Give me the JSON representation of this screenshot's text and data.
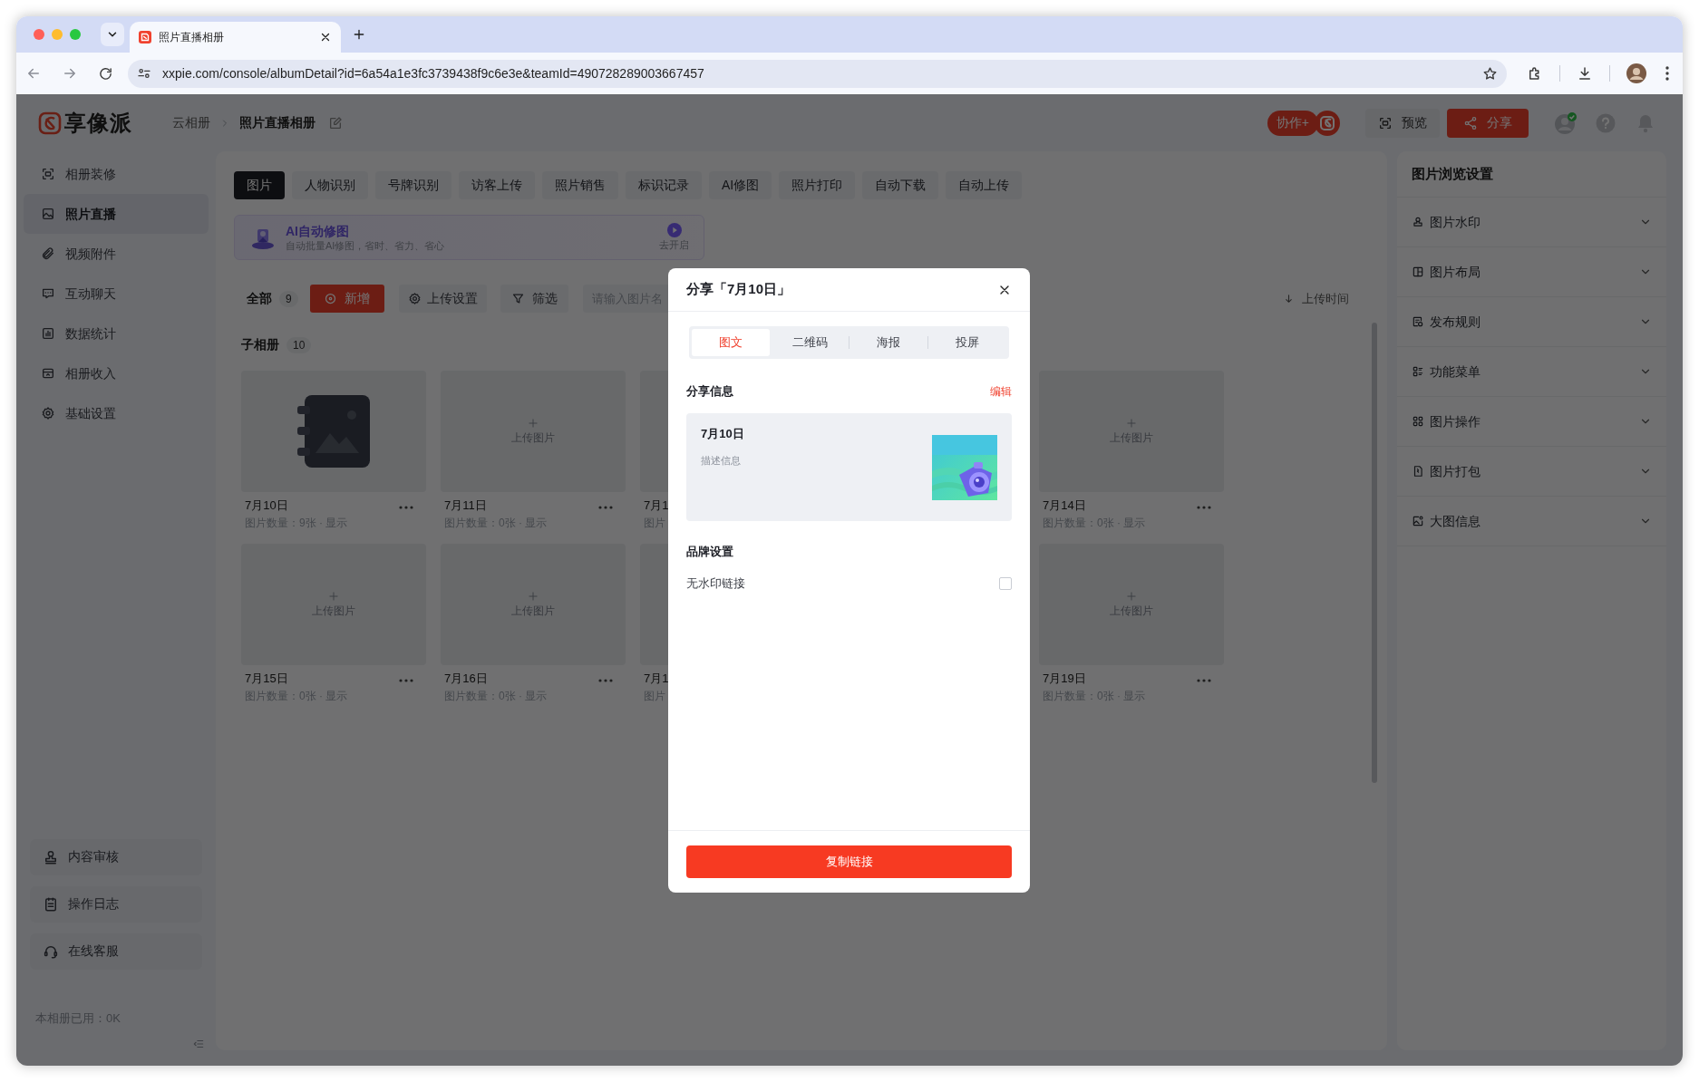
{
  "browser": {
    "tab_title": "照片直播相册",
    "url": "xxpie.com/console/albumDetail?id=6a54a1e3fc3739438f9c6e3e&teamId=490728289003667457"
  },
  "header": {
    "logo": "享像派",
    "breadcrumb": [
      "云相册",
      "照片直播相册"
    ],
    "collab_button": "协作+",
    "preview_button": "预览",
    "share_button": "分享"
  },
  "sidebar": {
    "items": [
      {
        "label": "相册装修",
        "selected": false
      },
      {
        "label": "照片直播",
        "selected": true
      },
      {
        "label": "视频附件",
        "selected": false
      },
      {
        "label": "互动聊天",
        "selected": false
      },
      {
        "label": "数据统计",
        "selected": false
      },
      {
        "label": "相册收入",
        "selected": false
      },
      {
        "label": "基础设置",
        "selected": false
      }
    ],
    "bottom_items": [
      "内容审核",
      "操作日志",
      "在线客服"
    ],
    "storage": "本相册已用：0K"
  },
  "content": {
    "tabs": [
      {
        "label": "图片",
        "selected": true
      },
      {
        "label": "人物识别",
        "selected": false
      },
      {
        "label": "号牌识别",
        "selected": false
      },
      {
        "label": "访客上传",
        "selected": false
      },
      {
        "label": "照片销售",
        "selected": false
      },
      {
        "label": "标识记录",
        "selected": false
      },
      {
        "label": "AI修图",
        "selected": false
      },
      {
        "label": "照片打印",
        "selected": false
      },
      {
        "label": "自动下载",
        "selected": false
      },
      {
        "label": "自动上传",
        "selected": false
      }
    ],
    "ai_banner": {
      "title": "AI自动修图",
      "subtitle": "自动批量AI修图，省时、省力、省心",
      "action": "去开启"
    },
    "toolbar": {
      "all_label": "全部",
      "all_count": "9",
      "add_button": "新增",
      "upload_settings": "上传设置",
      "filter": "筛选",
      "search_placeholder": "请输入图片名",
      "sort": "上传时间"
    },
    "sub_albums": {
      "label": "子相册",
      "count": "10",
      "rows": [
        [
          {
            "kind": "cover",
            "title": "7月10日",
            "info": "图片数量：9张 · 显示"
          },
          {
            "kind": "empty",
            "title": "7月11日",
            "info": "图片数量：0张 · 显示",
            "upload_label": "上传图片"
          },
          {
            "kind": "covered",
            "title": "7月1",
            "info": "图片"
          },
          {
            "kind": "empty",
            "title": "7月14日",
            "info": "图片数量：0张 · 显示",
            "upload_label": "上传图片"
          }
        ],
        [
          {
            "kind": "empty",
            "title": "7月15日",
            "info": "图片数量：0张 · 显示",
            "upload_label": "上传图片"
          },
          {
            "kind": "empty",
            "title": "7月16日",
            "info": "图片数量：0张 · 显示",
            "upload_label": "上传图片"
          },
          {
            "kind": "covered",
            "title": "7月1",
            "info": "图片"
          },
          {
            "kind": "empty",
            "title": "7月19日",
            "info": "图片数量：0张 · 显示",
            "upload_label": "上传图片"
          }
        ]
      ]
    }
  },
  "settings_panel": {
    "title": "图片浏览设置",
    "items": [
      "图片水印",
      "图片布局",
      "发布规则",
      "功能菜单",
      "图片操作",
      "图片打包",
      "大图信息"
    ]
  },
  "share_dialog": {
    "title": "分享「7月10日」",
    "tabs": [
      {
        "label": "图文",
        "selected": true
      },
      {
        "label": "二维码",
        "selected": false
      },
      {
        "label": "海报",
        "selected": false
      },
      {
        "label": "投屏",
        "selected": false
      }
    ],
    "section_title": "分享信息",
    "edit_link": "编辑",
    "card": {
      "title": "7月10日",
      "description": "描述信息"
    },
    "brand_title": "品牌设置",
    "options": [
      {
        "label": "无水印链接",
        "checked": false
      }
    ],
    "copy_button": "复制链接"
  }
}
